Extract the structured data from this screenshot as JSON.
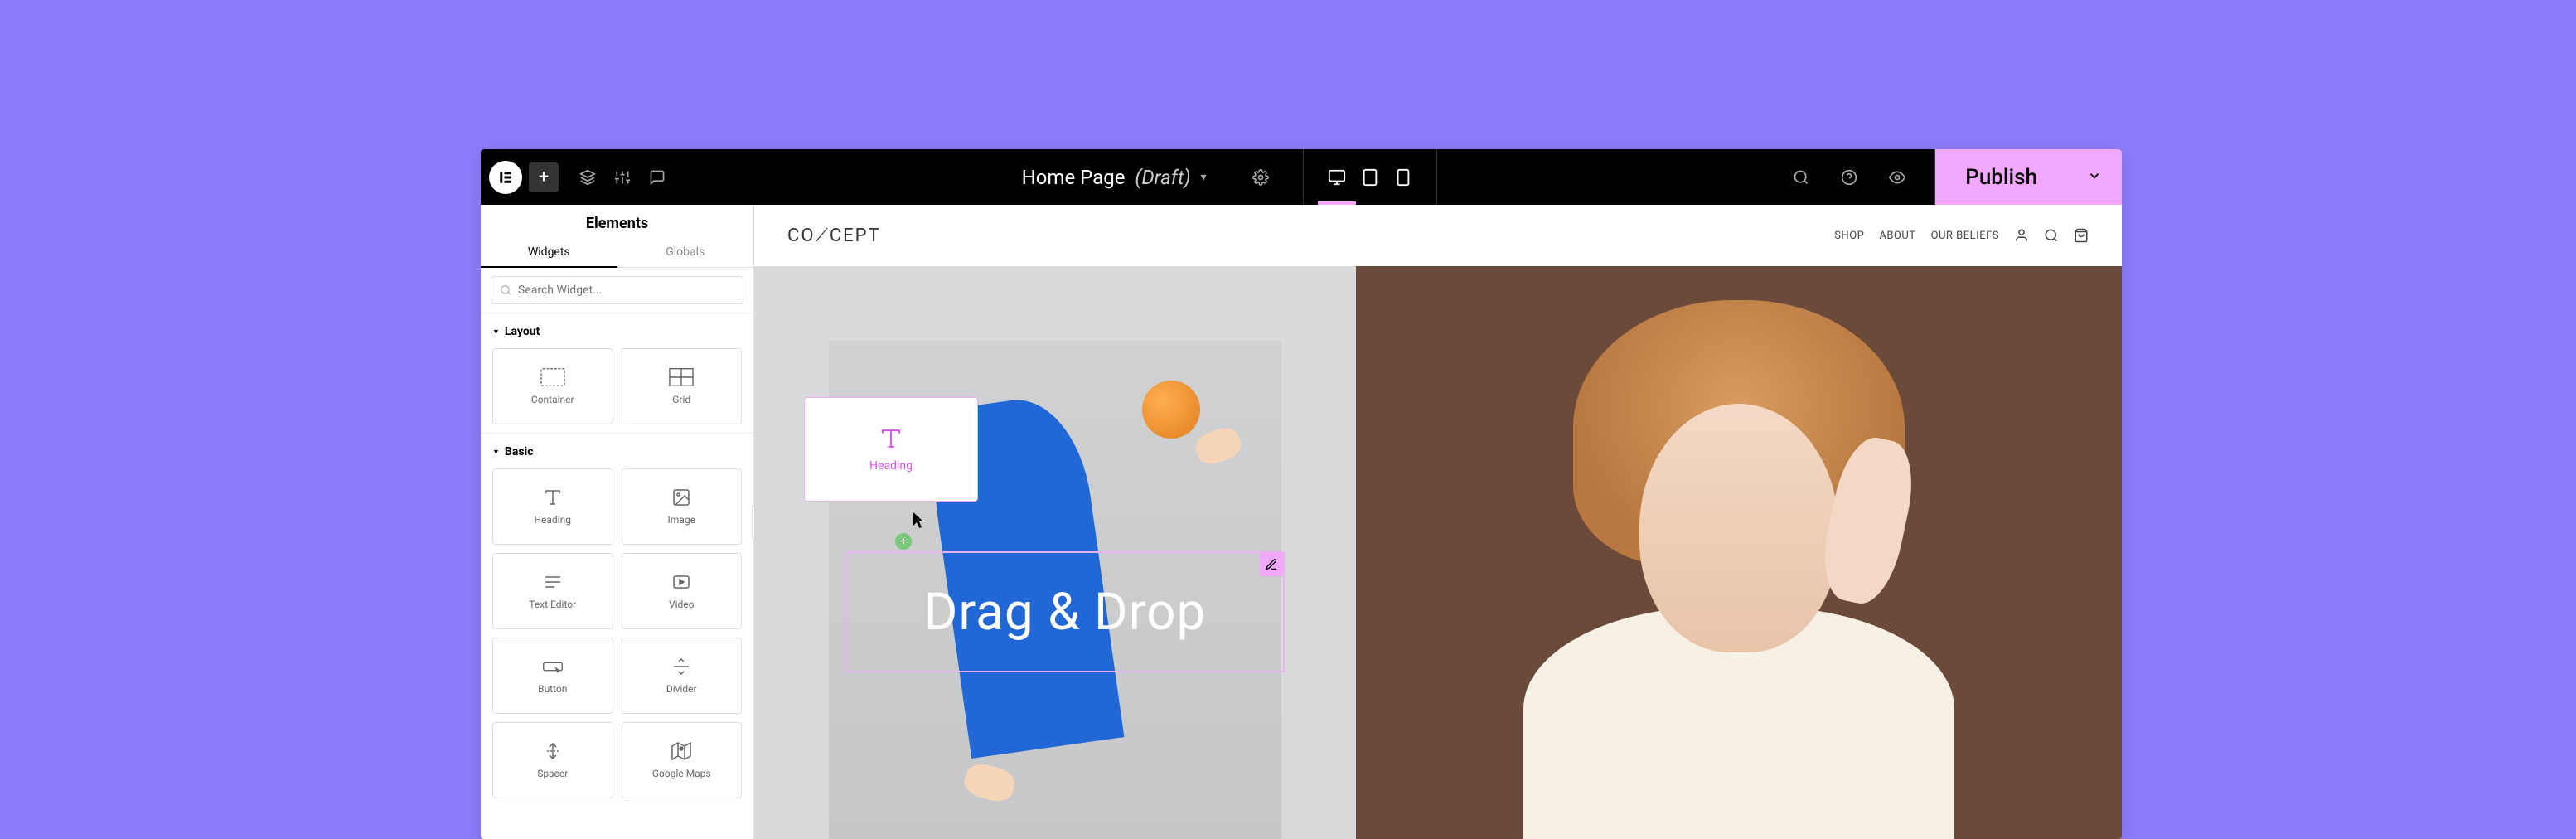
{
  "topbar": {
    "page_title": "Home Page",
    "status": "(Draft)",
    "publish": "Publish"
  },
  "device_quick": {
    "plus": "+",
    "drag": "⋮⋮⋮",
    "close": "✕"
  },
  "sidebar": {
    "title": "Elements",
    "tabs": {
      "widgets": "Widgets",
      "globals": "Globals"
    },
    "search_placeholder": "Search Widget...",
    "categories": {
      "layout": {
        "label": "Layout",
        "items": [
          {
            "label": "Container"
          },
          {
            "label": "Grid"
          }
        ]
      },
      "basic": {
        "label": "Basic",
        "items": [
          {
            "label": "Heading"
          },
          {
            "label": "Image"
          },
          {
            "label": "Text Editor"
          },
          {
            "label": "Video"
          },
          {
            "label": "Button"
          },
          {
            "label": "Divider"
          },
          {
            "label": "Spacer"
          },
          {
            "label": "Google Maps"
          }
        ]
      }
    }
  },
  "site": {
    "brand": "CO⟋CEPT",
    "nav": [
      {
        "label": "SHOP"
      },
      {
        "label": "ABOUT"
      },
      {
        "label": "OUR BELIEFS"
      }
    ]
  },
  "drag": {
    "widget_label": "Heading",
    "drop_text": "Drag & Drop"
  }
}
